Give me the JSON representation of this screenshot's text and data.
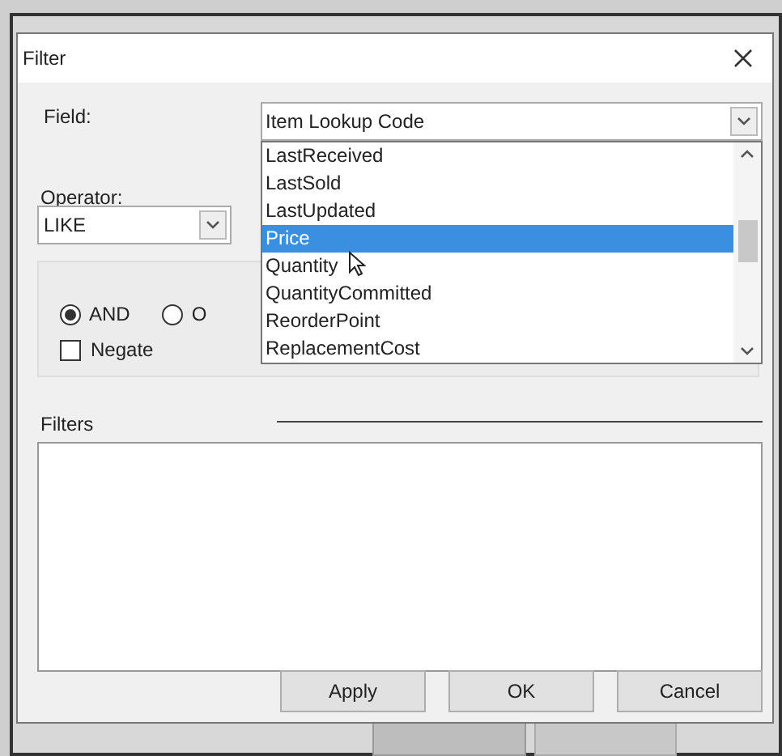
{
  "window": {
    "title": "Filter"
  },
  "field": {
    "label": "Field:",
    "value": "Item Lookup Code",
    "expanded": true,
    "options": [
      {
        "label": "LastReceived",
        "selected": false
      },
      {
        "label": "LastSold",
        "selected": false
      },
      {
        "label": "LastUpdated",
        "selected": false
      },
      {
        "label": "Price",
        "selected": true
      },
      {
        "label": "Quantity",
        "selected": false
      },
      {
        "label": "QuantityCommitted",
        "selected": false
      },
      {
        "label": "ReorderPoint",
        "selected": false
      },
      {
        "label": "ReplacementCost",
        "selected": false
      }
    ]
  },
  "operator": {
    "label": "Operator:",
    "value": "LIKE"
  },
  "logic": [
    {
      "label": "AND",
      "selected": true
    },
    {
      "label": "O",
      "selected": false
    }
  ],
  "negate": {
    "label": "Negate",
    "checked": false
  },
  "filters": {
    "label": "Filters"
  },
  "buttons": [
    "Apply",
    "OK",
    "Cancel"
  ]
}
